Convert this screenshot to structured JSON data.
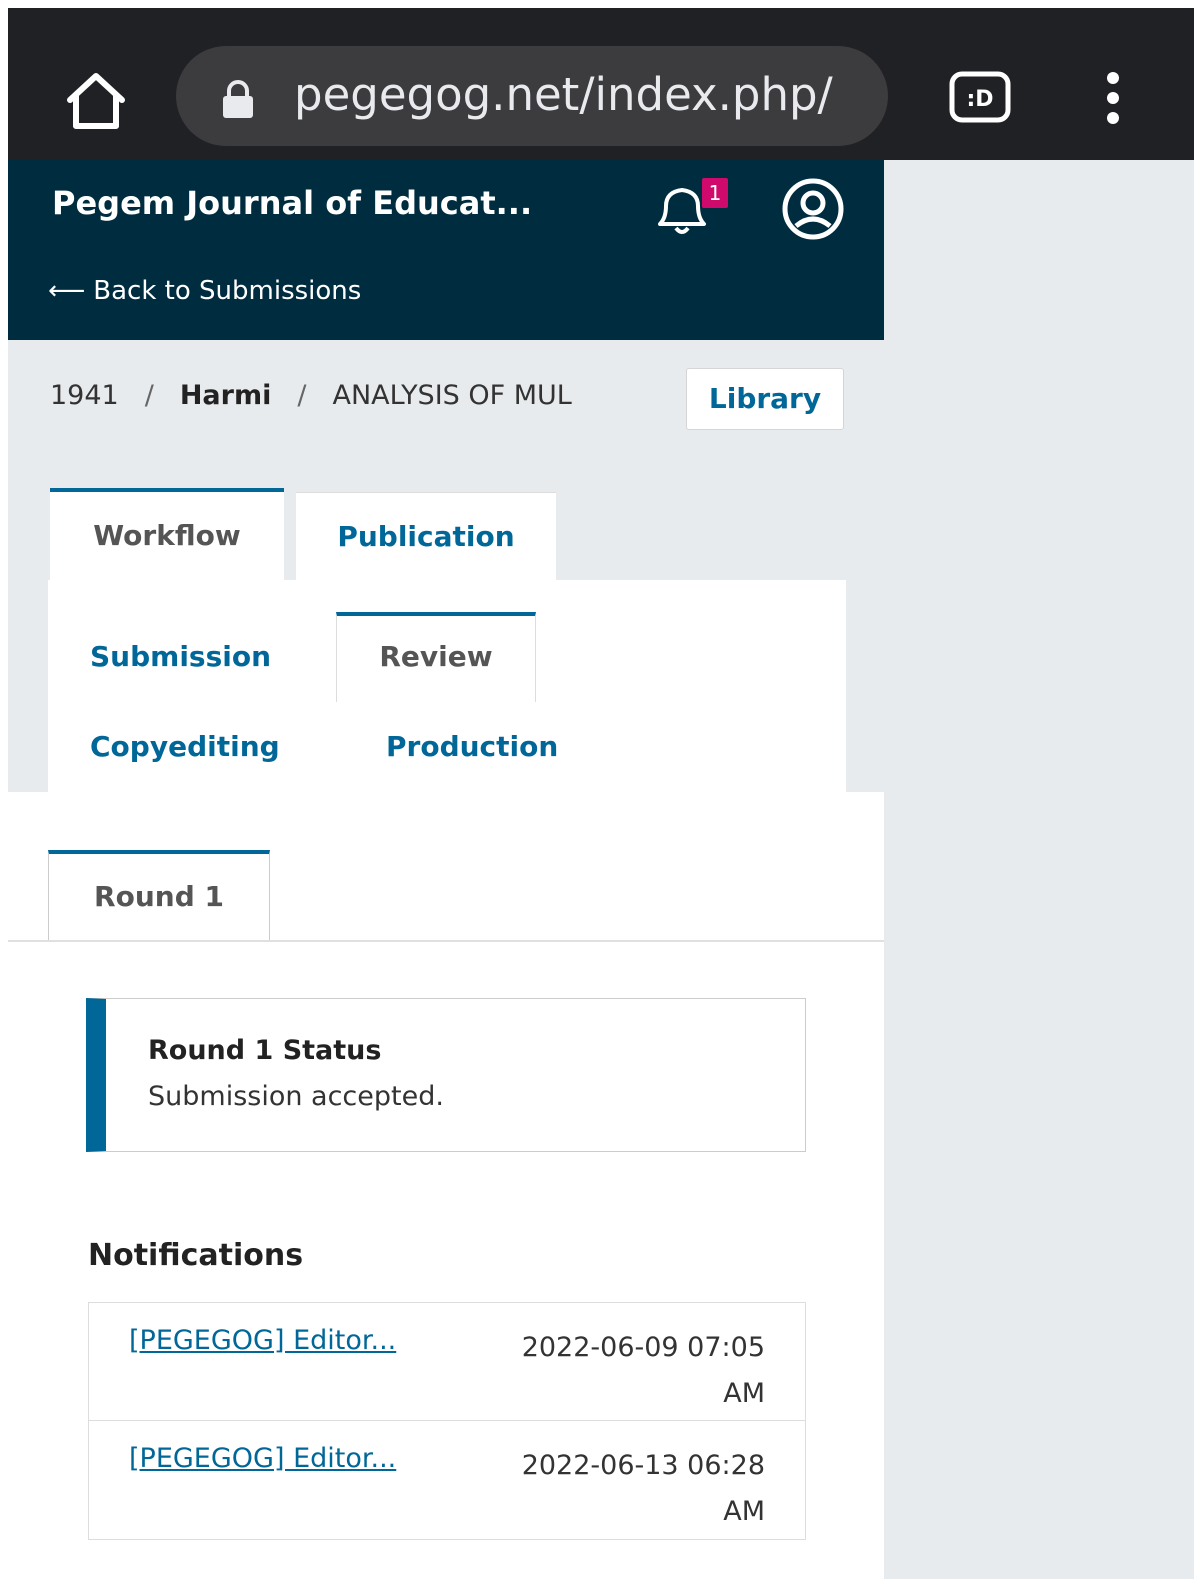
{
  "browser": {
    "url": "pegegog.net/index.php/"
  },
  "header": {
    "journal_title": "Pegem Journal of Educat...",
    "notification_count": "1",
    "back_link": "Back to Submissions",
    "back_arrow": "⟵"
  },
  "breadcrumb": {
    "id": "1941",
    "separator": "/",
    "author": "Harmi",
    "title": "ANALYSIS OF MUL",
    "library_button": "Library"
  },
  "tabs": {
    "workflow": "Workflow",
    "publication": "Publication"
  },
  "stages": {
    "submission": "Submission",
    "review": "Review",
    "copyediting": "Copyediting",
    "production": "Production"
  },
  "round": {
    "tab_label": "Round 1",
    "status_title": "Round 1 Status",
    "status_text": "Submission accepted."
  },
  "notifications": {
    "heading": "Notifications",
    "items": [
      {
        "subject": "[PEGEGOG] Editor...",
        "date": "2022-06-09 07:05 AM"
      },
      {
        "subject": "[PEGEGOG] Editor...",
        "date": "2022-06-13 06:28 AM"
      }
    ]
  },
  "colors": {
    "header_bg": "#002c40",
    "accent": "#006798",
    "badge": "#d00a6c"
  }
}
